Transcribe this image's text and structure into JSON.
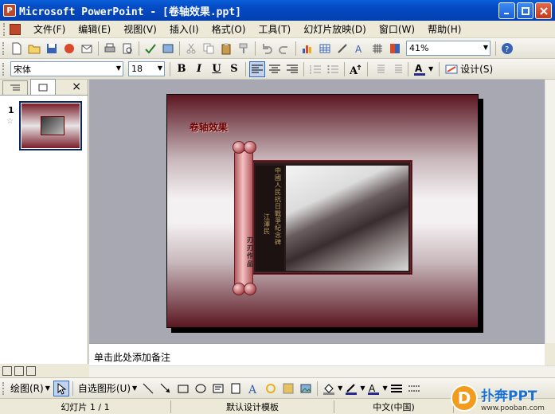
{
  "window": {
    "title": "Microsoft PowerPoint - [卷轴效果.ppt]",
    "app_icon": "P"
  },
  "menu": {
    "items": [
      "文件(F)",
      "编辑(E)",
      "视图(V)",
      "插入(I)",
      "格式(O)",
      "工具(T)",
      "幻灯片放映(D)",
      "窗口(W)",
      "帮助(H)"
    ]
  },
  "toolbar": {
    "zoom": "41%"
  },
  "format_toolbar": {
    "font_name": "宋体",
    "font_size": "18",
    "bold": "B",
    "italic": "I",
    "underline": "U",
    "shadow": "S",
    "design_label": "设计(S)"
  },
  "left_pane": {
    "close": "×",
    "slide_number": "1",
    "slide_star": "☆"
  },
  "slide": {
    "title": "卷轴效果",
    "scroll_caption": "刃刃作品",
    "calligraphy_col1": "中國人民抗日戰爭紀念碑",
    "calligraphy_col2": "江澤民"
  },
  "notes": {
    "placeholder": "单击此处添加备注"
  },
  "drawing_toolbar": {
    "draw_label": "绘图(R)",
    "autoshapes_label": "自选图形(U)"
  },
  "status_bar": {
    "slide_info": "幻灯片 1 / 1",
    "template": "默认设计模板",
    "language": "中文(中国)"
  },
  "watermark": {
    "logo": "D",
    "name": "扑奔PPT",
    "url": "www.pooban.com"
  },
  "colors": {
    "titlebar": "#0449c3",
    "slide_dark": "#5b1620",
    "slide_title": "#6e0000",
    "scroll_pink": "#f4c1c3"
  }
}
